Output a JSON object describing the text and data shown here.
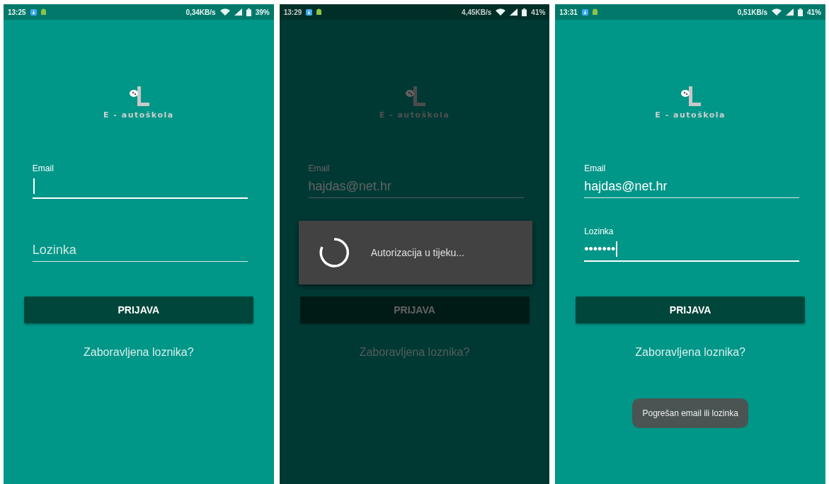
{
  "screens": [
    {
      "status_bar": {
        "time": "13:25",
        "speed": "0,34KB/s",
        "battery": "39%"
      },
      "logo_text": "E - autoškola",
      "fields": [
        {
          "label": "Email",
          "focused": true
        },
        {
          "placeholder": "Lozinka",
          "focused": false
        }
      ],
      "button": "PRIJAVA",
      "link": "Zaboravljena loznika?",
      "dimmed": false
    },
    {
      "status_bar": {
        "time": "13:29",
        "speed": "4,45KB/s",
        "battery": "41%"
      },
      "logo_text": "E - autoškola",
      "fields": [
        {
          "label": "Email",
          "value": "hajdas@net.hr",
          "focused": false
        }
      ],
      "button": "PRIJAVA",
      "link": "Zaboravljena loznika?",
      "dimmed": true,
      "dialog": {
        "message": "Autorizacija u tijeku..."
      }
    },
    {
      "status_bar": {
        "time": "13:31",
        "speed": "0,51KB/s",
        "battery": "41%"
      },
      "logo_text": "E - autoškola",
      "fields": [
        {
          "label": "Email",
          "value": "hajdas@net.hr",
          "focused": false
        },
        {
          "label": "Lozinka",
          "value": "•••••••",
          "focused": true
        }
      ],
      "button": "PRIJAVA",
      "link": "Zaboravljena loznika?",
      "dimmed": false,
      "toast": "Pogrešan email ili lozinka"
    }
  ]
}
